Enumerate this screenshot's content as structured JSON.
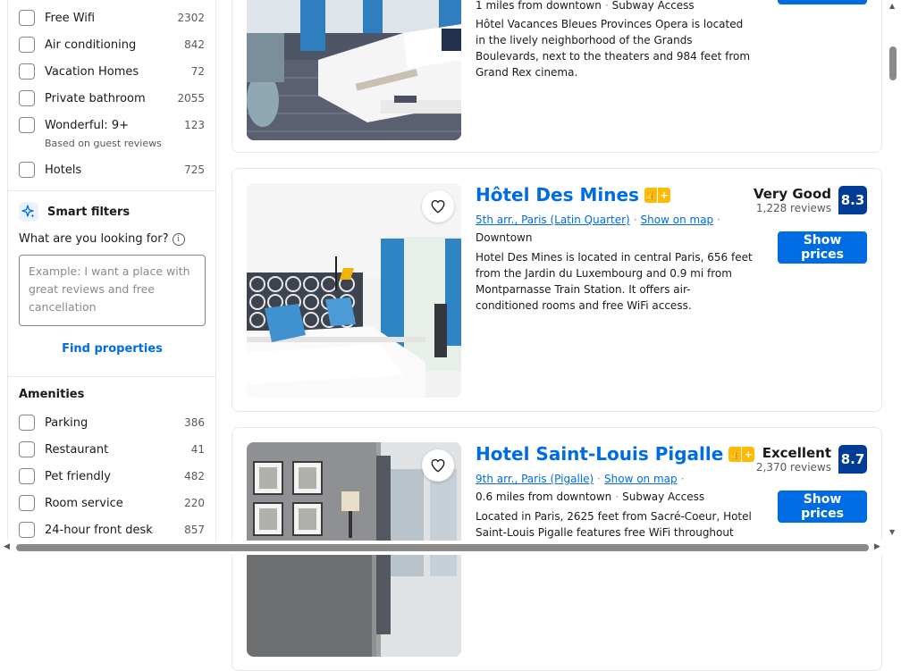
{
  "filters_top": [
    {
      "label": "Free Wifi",
      "count": "2302"
    },
    {
      "label": "Air conditioning",
      "count": "842"
    },
    {
      "label": "Vacation Homes",
      "count": "72"
    },
    {
      "label": "Private bathroom",
      "count": "2055"
    },
    {
      "label": "Wonderful: 9+",
      "count": "123",
      "sub": "Based on guest reviews"
    },
    {
      "label": "Hotels",
      "count": "725"
    }
  ],
  "smart_filters": {
    "title": "Smart filters",
    "question": "What are you looking for?",
    "placeholder": "Example: I want a place with great reviews and free cancellation",
    "button": "Find properties"
  },
  "amenities": {
    "title": "Amenities",
    "items": [
      {
        "label": "Parking",
        "count": "386"
      },
      {
        "label": "Restaurant",
        "count": "41"
      },
      {
        "label": "Pet friendly",
        "count": "482"
      },
      {
        "label": "Room service",
        "count": "220"
      },
      {
        "label": "24-hour front desk",
        "count": "857"
      }
    ]
  },
  "hotels": [
    {
      "distance": "1 miles from downtown",
      "access": "Subway Access",
      "description": "Hôtel Vacances Bleues Provinces Opera is located in the lively neighborhood of the Grands Boulevards, next to the theaters and 984 feet from Grand Rex cinema."
    },
    {
      "name": "Hôtel Des Mines",
      "area": "5th arr., Paris (Latin Quarter)",
      "map_link": "Show on map",
      "distance": "Downtown",
      "description": "Hotel Des Mines is located in central Paris, 656 feet from the Jardin du Luxembourg and 0.9 mi from Montparnasse Train Station. It offers air-conditioned rooms and free WiFi access.",
      "score_word": "Very Good",
      "reviews": "1,228 reviews",
      "score": "8.3",
      "button": "Show prices"
    },
    {
      "name": "Hotel Saint-Louis Pigalle",
      "area": "9th arr., Paris (Pigalle)",
      "map_link": "Show on map",
      "distance": "0.6 miles from downtown",
      "access": "Subway Access",
      "description": "Located in Paris, 2625 feet from Sacré-Coeur, Hotel Saint-Louis Pigalle features free WiFi throughout the property",
      "score_word": "Excellent",
      "reviews": "2,370 reviews",
      "score": "8.7",
      "button": "Show prices"
    }
  ],
  "colors": {
    "accent": "#006ce4",
    "score_badge": "#003b95",
    "genius": "#febb02"
  }
}
